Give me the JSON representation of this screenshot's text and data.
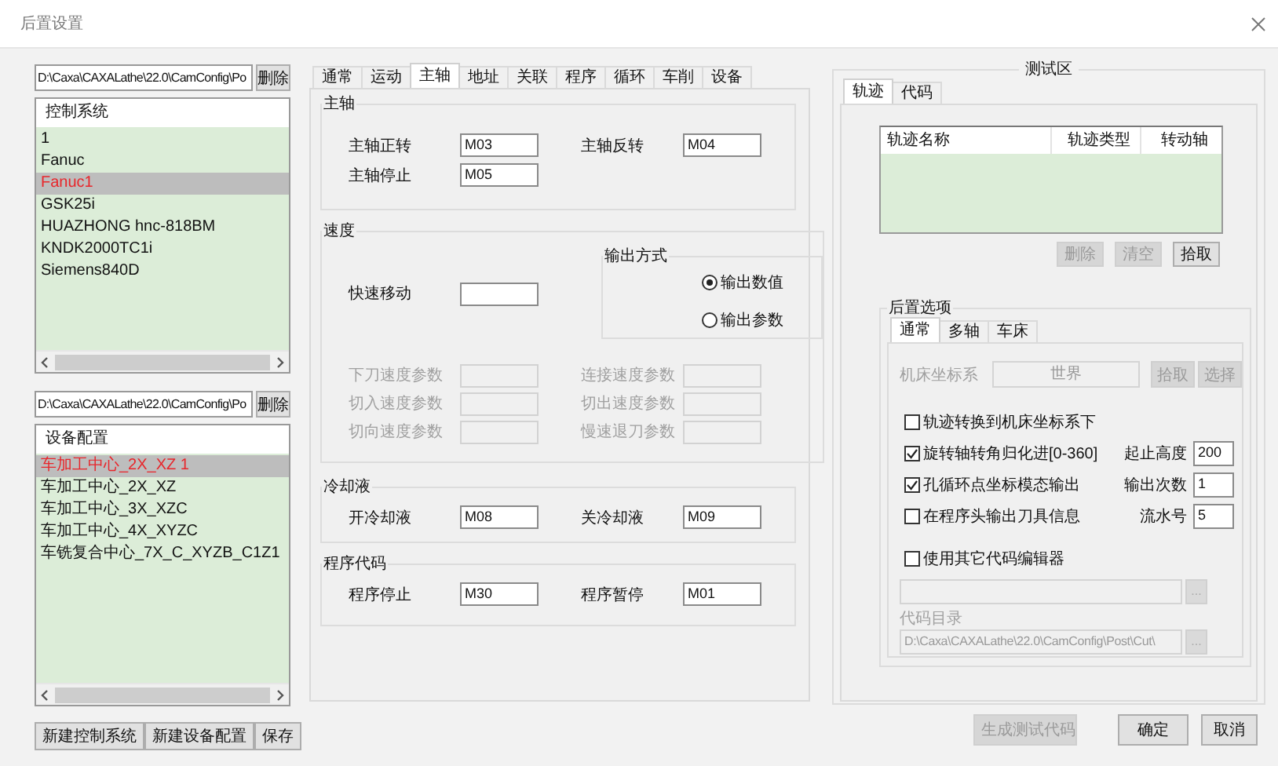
{
  "window": {
    "title": "后置设置"
  },
  "control_systems": {
    "path": "D:\\Caxa\\CAXALathe\\22.0\\CamConfig\\Po",
    "delete_button": "删除",
    "header": "控制系统",
    "items": [
      {
        "label": "1",
        "selected": false
      },
      {
        "label": "Fanuc",
        "selected": false
      },
      {
        "label": "Fanuc1",
        "selected": true
      },
      {
        "label": "GSK25i",
        "selected": false
      },
      {
        "label": "HUAZHONG hnc-818BM",
        "selected": false
      },
      {
        "label": "KNDK2000TC1i",
        "selected": false
      },
      {
        "label": "Siemens840D",
        "selected": false
      }
    ]
  },
  "devices": {
    "path": "D:\\Caxa\\CAXALathe\\22.0\\CamConfig\\Po",
    "delete_button": "删除",
    "header": "设备配置",
    "items": [
      {
        "label": "车加工中心_2X_XZ 1",
        "selected": true
      },
      {
        "label": "车加工中心_2X_XZ",
        "selected": false
      },
      {
        "label": "车加工中心_3X_XZC",
        "selected": false
      },
      {
        "label": "车加工中心_4X_XYZC",
        "selected": false
      },
      {
        "label": "车铣复合中心_7X_C_XYZB_C1Z1",
        "selected": false
      }
    ]
  },
  "left_buttons": [
    "新建控制系统",
    "新建设备配置",
    "保存"
  ],
  "tabs": [
    {
      "label": "通常",
      "selected": false
    },
    {
      "label": "运动",
      "selected": false
    },
    {
      "label": "主轴",
      "selected": true
    },
    {
      "label": "地址",
      "selected": false
    },
    {
      "label": "关联",
      "selected": false
    },
    {
      "label": "程序",
      "selected": false
    },
    {
      "label": "循环",
      "selected": false
    },
    {
      "label": "车削",
      "selected": false
    },
    {
      "label": "设备",
      "selected": false
    }
  ],
  "spindle": {
    "title": "主轴",
    "fields": [
      {
        "label": "主轴正转",
        "value": "M03"
      },
      {
        "label": "主轴反转",
        "value": "M04"
      },
      {
        "label": "主轴停止",
        "value": "M05"
      }
    ]
  },
  "speed": {
    "title": "速度",
    "rapid": {
      "label": "快速移动"
    },
    "output_mode": {
      "title": "输出方式",
      "options": [
        {
          "label": "输出数值",
          "selected": true
        },
        {
          "label": "输出参数",
          "selected": false
        }
      ]
    },
    "params": [
      {
        "label": "下刀速度参数",
        "disabled": true
      },
      {
        "label": "连接速度参数",
        "disabled": true
      },
      {
        "label": "切入速度参数",
        "disabled": true
      },
      {
        "label": "切出速度参数",
        "disabled": true
      },
      {
        "label": "切向速度参数",
        "disabled": true
      },
      {
        "label": "慢速退刀参数",
        "disabled": true
      }
    ]
  },
  "coolant": {
    "title": "冷却液",
    "fields": [
      {
        "label": "开冷却液",
        "value": "M08"
      },
      {
        "label": "关冷却液",
        "value": "M09"
      }
    ]
  },
  "program_code": {
    "title": "程序代码",
    "fields": [
      {
        "label": "程序停止",
        "value": "M30"
      },
      {
        "label": "程序暂停",
        "value": "M01"
      }
    ]
  },
  "test_area": {
    "title": "测试区",
    "tabs": [
      {
        "label": "轨迹",
        "selected": true
      },
      {
        "label": "代码",
        "selected": false
      }
    ],
    "columns": [
      "轨迹名称",
      "轨迹类型",
      "转动轴"
    ],
    "buttons": [
      {
        "label": "删除",
        "disabled": true
      },
      {
        "label": "清空",
        "disabled": true
      },
      {
        "label": "拾取",
        "disabled": false
      }
    ],
    "post_options": {
      "title": "后置选项",
      "tabs": [
        {
          "label": "通常",
          "selected": true
        },
        {
          "label": "多轴",
          "selected": false
        },
        {
          "label": "车床",
          "selected": false
        }
      ],
      "coord": {
        "label": "机床坐标系",
        "value": "世界",
        "disabled": true
      },
      "coord_buttons": [
        {
          "label": "拾取",
          "disabled": true
        },
        {
          "label": "选择",
          "disabled": true
        }
      ],
      "options": [
        {
          "label": "轨迹转换到机床坐标系下",
          "checked": false
        },
        {
          "label": "旋转轴转角归化进[0-360]",
          "checked": true,
          "field": {
            "label": "起止高度",
            "value": "200"
          }
        },
        {
          "label": "孔循环点坐标模态输出",
          "checked": true,
          "field": {
            "label": "输出次数",
            "value": "1"
          }
        },
        {
          "label": "在程序头输出刀具信息",
          "checked": false,
          "field": {
            "label": "流水号",
            "value": "5"
          }
        }
      ],
      "editor": {
        "label": "使用其它代码编辑器",
        "checked": false
      },
      "editor_path": {
        "disabled": true,
        "browse": "..."
      },
      "code_dir": {
        "label": "代码目录",
        "value": "D:\\Caxa\\CAXALathe\\22.0\\CamConfig\\Post\\Cut\\",
        "disabled": true,
        "browse": "..."
      }
    }
  },
  "footer_buttons": [
    {
      "label": "生成测试代码",
      "disabled": true
    },
    {
      "label": "确定",
      "disabled": false
    },
    {
      "label": "取消",
      "disabled": false
    }
  ]
}
